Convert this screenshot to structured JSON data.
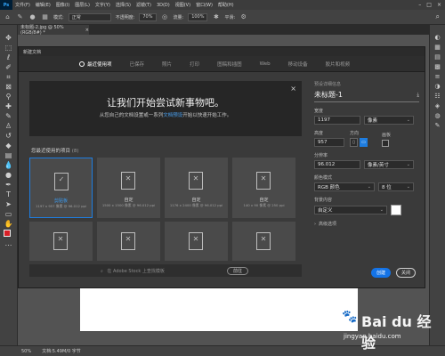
{
  "menubar": {
    "logo": "Ps",
    "items": [
      "文件(F)",
      "编辑(E)",
      "图像(I)",
      "图层(L)",
      "文字(Y)",
      "选择(S)",
      "滤镜(T)",
      "3D(D)",
      "视图(V)",
      "窗口(W)",
      "帮助(H)"
    ]
  },
  "options": {
    "mode_label": "模式:",
    "mode_value": "正常",
    "opacity_label": "不透明度:",
    "opacity_value": "70%",
    "flow_label": "流量:",
    "flow_value": "100%",
    "smooth_label": "平滑:"
  },
  "document": {
    "tab_title": "未标题-2.jpg @ 50%(RGB/8#) *",
    "tab_close": "×"
  },
  "dialog": {
    "title": "新建文档",
    "tabs": [
      "最近使用项",
      "已保存",
      "照片",
      "打印",
      "图稿和插图",
      "Web",
      "移动设备",
      "胶片和视频"
    ],
    "banner_title": "让我们开始尝试新事物吧。",
    "banner_sub_before": "从您自己的文档设置或一系列",
    "banner_sub_link": "文档预设",
    "banner_sub_after": "开始以快速开始工作。",
    "banner_close": "×",
    "recent_label": "您最近使用的项目",
    "recent_count": "(8)",
    "presets": [
      {
        "name": "剪贴板",
        "dims": "1197 x 957 像素 @ 96.012 ppi"
      },
      {
        "name": "自定",
        "dims": "1500 x 1500 像素 @ 96.012 ppi"
      },
      {
        "name": "自定",
        "dims": "1176 x 2400 像素 @ 96.012 ppi"
      },
      {
        "name": "自定",
        "dims": "140 x 90 像素 @ 250 ppi"
      }
    ],
    "stock_placeholder": "在 Adobe Stock 上查找模板",
    "stock_button": "前往"
  },
  "preset_details": {
    "heading": "预设详细信息",
    "doc_name": "未标题-1",
    "width_label": "宽度",
    "width_value": "1197",
    "width_unit": "像素",
    "height_label": "高度",
    "height_value": "957",
    "orientation_label": "方向",
    "artboard_label": "画板",
    "resolution_label": "分辨率",
    "resolution_value": "96.012",
    "resolution_unit": "像素/英寸",
    "color_mode_label": "颜色模式",
    "color_mode_value": "RGB 颜色",
    "bit_depth": "8 位",
    "background_label": "背景内容",
    "background_value": "自定义",
    "advanced_label": "高级选项",
    "create_button": "创建",
    "close_button": "关闭"
  },
  "status": {
    "zoom": "50%",
    "doc_info": "文档:5.49M/0 字节"
  },
  "watermark": {
    "site": "Bai du 经验",
    "url": "jingyan.baidu.com"
  },
  "colors": {
    "accent": "#1473e6",
    "foreground_swatch": "#d91f26",
    "background_swatch": "#ffffff"
  }
}
